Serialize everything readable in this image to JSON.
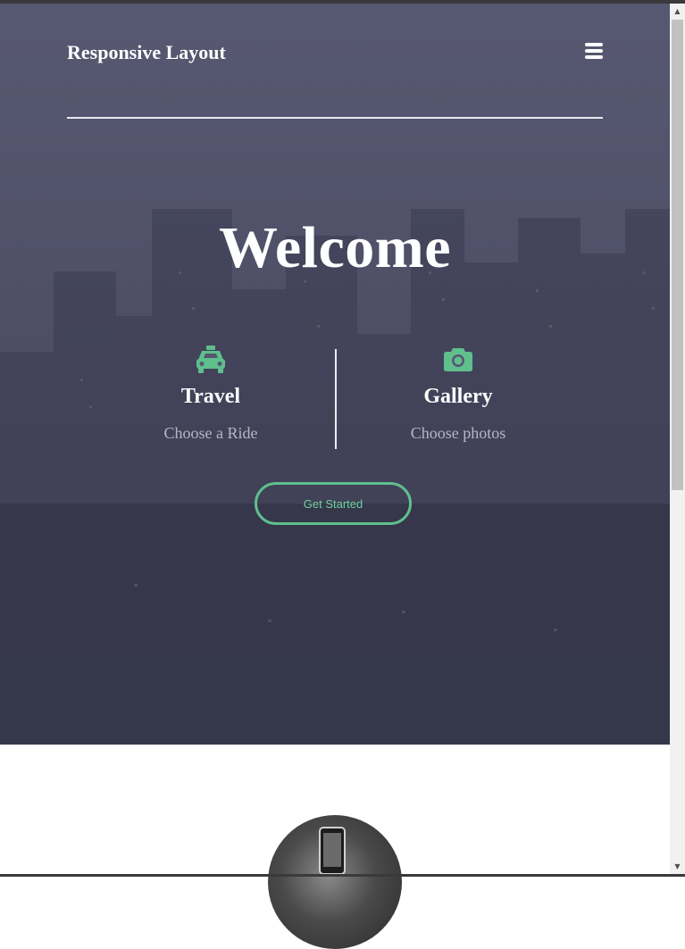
{
  "header": {
    "brand": "Responsive Layout",
    "menu_icon": "hamburger-icon"
  },
  "hero": {
    "title": "Welcome",
    "features": [
      {
        "icon": "taxi-icon",
        "title": "Travel",
        "subtitle": "Choose a Ride"
      },
      {
        "icon": "camera-icon",
        "title": "Gallery",
        "subtitle": "Choose photos"
      }
    ],
    "cta_label": "Get Started"
  },
  "colors": {
    "accent": "#5fbf8d",
    "hero_overlay": "#565770",
    "muted_text": "#b6b6c4"
  }
}
